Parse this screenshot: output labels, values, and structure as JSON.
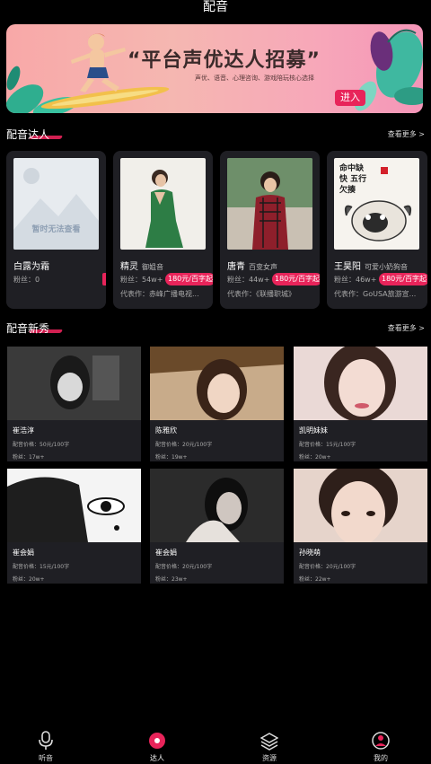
{
  "header": {
    "title": "配音"
  },
  "banner": {
    "headline": "“平台声优达人招募”",
    "subtitle": "声优、语音、心理咨询、游戏陪玩核心选择",
    "enter_label": "进入"
  },
  "sections": {
    "talents": {
      "title": "配音达人",
      "more": "查看更多 >"
    },
    "newcomers": {
      "title": "配音新秀",
      "more": "查看更多 >"
    }
  },
  "talents": [
    {
      "name": "白露为霜",
      "tag": "",
      "fans": "粉丝：0",
      "price": "",
      "works": "",
      "placeholder_text": "暂时无法查看"
    },
    {
      "name": "精灵",
      "tag": "御姐音",
      "fans": "粉丝：54w+",
      "price": "180元/百字起",
      "works": "代表作：赤峰广播电视..."
    },
    {
      "name": "唐青",
      "tag": "百变女声",
      "fans": "粉丝：44w+",
      "price": "180元/百字起",
      "works": "代表作：《联播职城》"
    },
    {
      "name": "王昊阳",
      "tag": "可爱小奶狗音",
      "fans": "粉丝：46w+",
      "price": "180元/百字起",
      "works": "代表作：GoUSA旅游宣...",
      "poster_text": "命中缺快 五行欠揍"
    }
  ],
  "newcomers": [
    {
      "name": "崔浩淳",
      "price": "配音价格：50元/100字",
      "fans": "粉丝：17w+"
    },
    {
      "name": "陈雅欣",
      "price": "配音价格：20元/100字",
      "fans": "粉丝：19w+"
    },
    {
      "name": "凯明妹妹",
      "price": "配音价格：15元/100字",
      "fans": "粉丝：20w+"
    },
    {
      "name": "崔会娟",
      "price": "配音价格：15元/100字",
      "fans": "粉丝：20w+"
    },
    {
      "name": "崔会娟",
      "price": "配音价格：20元/100字",
      "fans": "粉丝：23w+"
    },
    {
      "name": "孙晓萌",
      "price": "配音价格：20元/100字",
      "fans": "粉丝：22w+"
    }
  ],
  "tabbar": [
    {
      "label": "听音",
      "icon": "microphone-icon"
    },
    {
      "label": "达人",
      "icon": "badge-icon",
      "active": true
    },
    {
      "label": "资源",
      "icon": "layers-icon"
    },
    {
      "label": "我的",
      "icon": "person-icon"
    }
  ],
  "colors": {
    "accent": "#e8245a",
    "card_bg": "#1f1f24",
    "page_bg": "#000000"
  }
}
